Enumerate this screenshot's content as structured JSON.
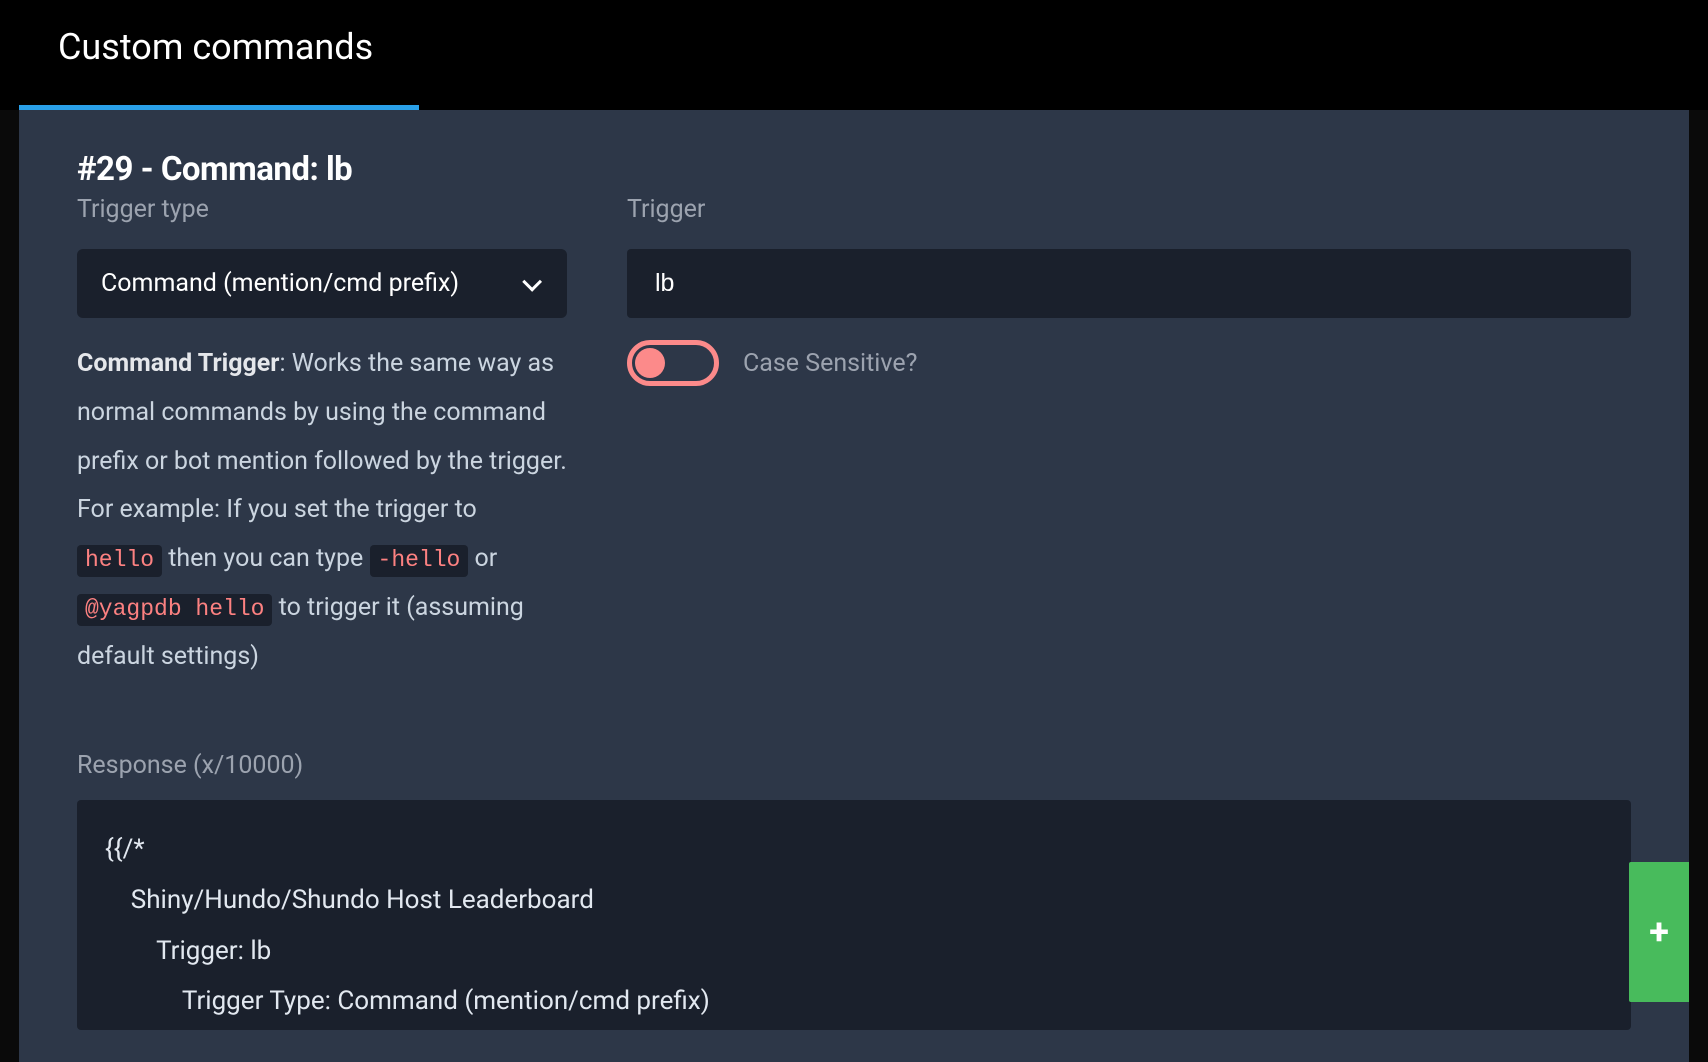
{
  "header": {
    "title": "Custom commands"
  },
  "command": {
    "heading": "#29 - Command: lb",
    "trigger_type_label": "Trigger type",
    "trigger_label": "Trigger",
    "trigger_type_value": "Command (mention/cmd prefix)",
    "trigger_value": "lb",
    "case_sensitive_label": "Case Sensitive?",
    "case_sensitive_on": false,
    "help": {
      "strong": "Command Trigger",
      "part1": ": Works the same way as normal commands by using the command prefix or bot mention followed by the trigger.",
      "part2a": "For example: If you set the trigger to ",
      "code1": "hello",
      "part2b": " then you can type ",
      "code2": "-hello",
      "part2c": " or ",
      "code3": "@yagpdb hello",
      "part2d": " to trigger it (assuming default settings)"
    },
    "response_label": "Response (x/10000)",
    "response_code": "{{/*\n    Shiny/Hundo/Shundo Host Leaderboard\n        Trigger: lb\n            Trigger Type: Command (mention/cmd prefix)"
  },
  "icons": {
    "plus": "+"
  }
}
